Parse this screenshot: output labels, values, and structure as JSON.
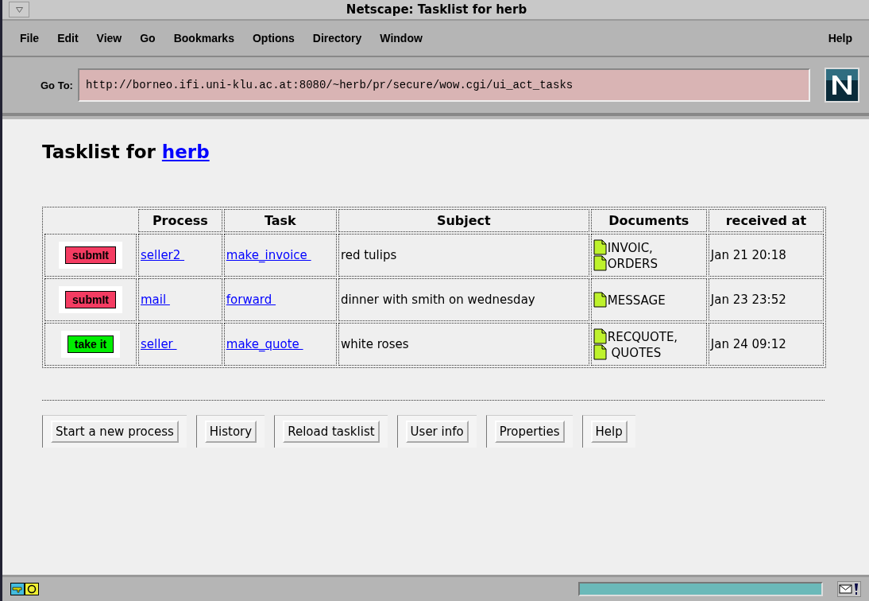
{
  "window": {
    "title": "Netscape: Tasklist for herb"
  },
  "menu": [
    "File",
    "Edit",
    "View",
    "Go",
    "Bookmarks",
    "Options",
    "Directory",
    "Window"
  ],
  "help_menu": "Help",
  "location": {
    "label": "Go To:",
    "value": "http://borneo.ifi.uni-klu.ac.at:8080/~herb/pr/secure/wow.cgi/ui_act_tasks"
  },
  "heading": {
    "text": "Tasklist for ",
    "user": "herb"
  },
  "table": {
    "columns": [
      "Process",
      "Task",
      "Subject",
      "Documents",
      "received at"
    ],
    "rows": [
      {
        "action": {
          "label": "submIt",
          "kind": "submit"
        },
        "process": "seller2 ",
        "task": "make_invoice ",
        "subject": "red tulips",
        "documents": [
          "INVOIC,",
          "ORDERS"
        ],
        "received": "Jan 21 20:18"
      },
      {
        "action": {
          "label": "submIt",
          "kind": "submit"
        },
        "process": "mail ",
        "task": "forward ",
        "subject": "dinner with smith on wednesday",
        "documents": [
          "MESSAGE"
        ],
        "received": "Jan 23 23:52"
      },
      {
        "action": {
          "label": "take it",
          "kind": "take"
        },
        "process": "seller ",
        "task": "make_quote ",
        "subject": "white roses",
        "documents": [
          "RECQUOTE,",
          " QUOTES"
        ],
        "received": "Jan 24 09:12"
      }
    ]
  },
  "buttons": [
    "Start a new process",
    "History",
    "Reload tasklist",
    "User info",
    "Properties",
    "Help"
  ]
}
